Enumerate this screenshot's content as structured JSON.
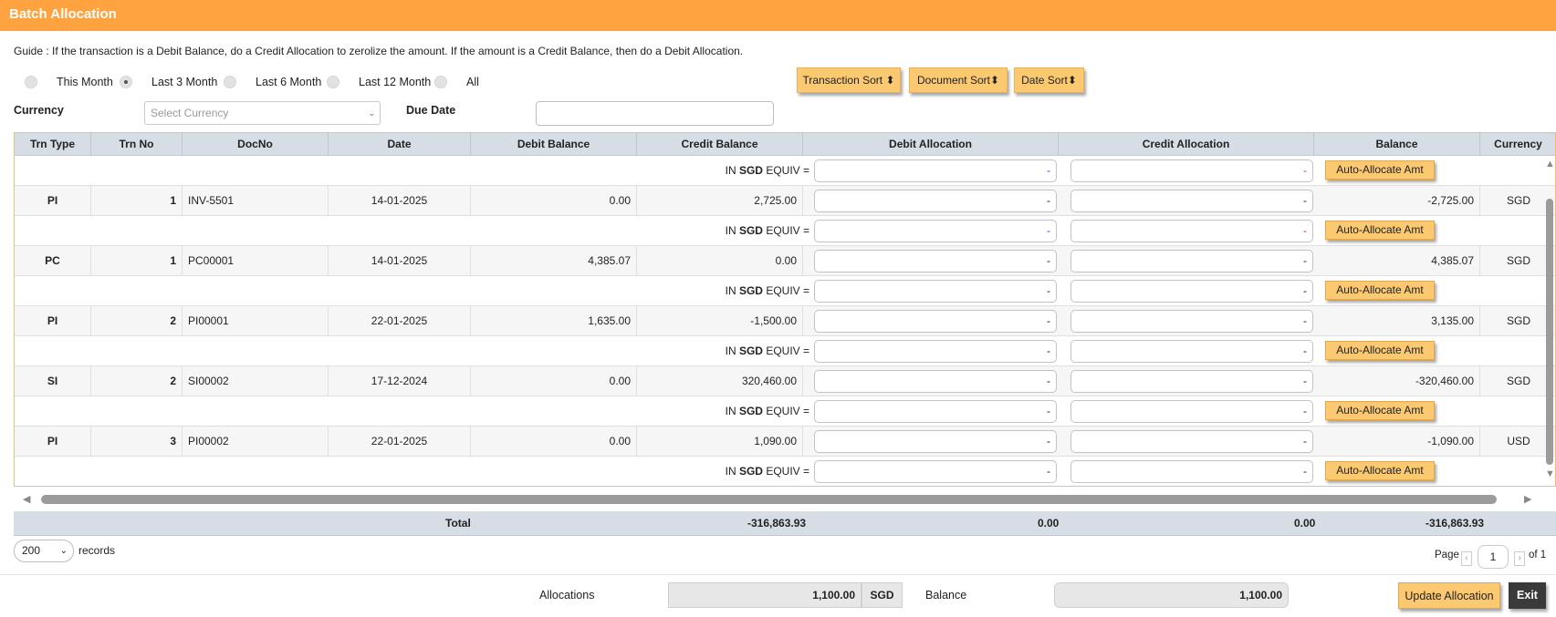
{
  "window": {
    "title": "Batch Allocation"
  },
  "guide": "Guide : If the transaction is a Debit Balance, do a Credit Allocation to zerolize the amount. If the amount is a Credit Balance, then do a Debit Allocation.",
  "period": {
    "selected": "Last 3 Month",
    "options": [
      "This Month",
      "Last 3 Month",
      "Last 6 Month",
      "Last 12 Month",
      "All"
    ]
  },
  "sort_buttons": [
    "Transaction Sort",
    "Document Sort",
    "Date Sort"
  ],
  "filters": {
    "currency_label": "Currency",
    "currency_placeholder": "Select Currency",
    "due_date_label": "Due Date",
    "due_date_value": ""
  },
  "table": {
    "columns": [
      "Trn Type",
      "Trn No",
      "DocNo",
      "Date",
      "Debit Balance",
      "Credit Balance",
      "Debit Allocation",
      "Credit Allocation",
      "Balance",
      "Currency"
    ],
    "equiv_text": {
      "prefix": "IN",
      "currency": "SGD",
      "suffix": "EQUIV ="
    },
    "alloc_placeholder": "-",
    "auto_button": "Auto-Allocate Amt",
    "rows": [
      {
        "trn_type": "PI",
        "trn_no": "1",
        "doc_no": "INV-5501",
        "date": "14-01-2025",
        "debit_balance": "0.00",
        "credit_balance": "2,725.00",
        "balance": "-2,725.00",
        "currency": "SGD"
      },
      {
        "trn_type": "PC",
        "trn_no": "1",
        "doc_no": "PC00001",
        "date": "14-01-2025",
        "debit_balance": "4,385.07",
        "credit_balance": "0.00",
        "balance": "4,385.07",
        "currency": "SGD"
      },
      {
        "trn_type": "PI",
        "trn_no": "2",
        "doc_no": "PI00001",
        "date": "22-01-2025",
        "debit_balance": "1,635.00",
        "credit_balance": "-1,500.00",
        "balance": "3,135.00",
        "currency": "SGD"
      },
      {
        "trn_type": "SI",
        "trn_no": "2",
        "doc_no": "SI00002",
        "date": "17-12-2024",
        "debit_balance": "0.00",
        "credit_balance": "320,460.00",
        "balance": "-320,460.00",
        "currency": "SGD"
      },
      {
        "trn_type": "PI",
        "trn_no": "3",
        "doc_no": "PI00002",
        "date": "22-01-2025",
        "debit_balance": "0.00",
        "credit_balance": "1,090.00",
        "balance": "-1,090.00",
        "currency": "USD"
      }
    ]
  },
  "totals": {
    "label": "Total",
    "credit_balance": "-316,863.93",
    "debit_allocation": "0.00",
    "credit_allocation": "0.00",
    "balance": "-316,863.93"
  },
  "paging": {
    "page_size": "200",
    "records_label": "records",
    "page_label": "Page",
    "page_value": "1",
    "of_label": "of 1"
  },
  "footer": {
    "allocations_label": "Allocations",
    "allocations_value": "1,100.00",
    "currency": "SGD",
    "balance_label": "Balance",
    "balance_value": "1,100.00",
    "update_button": "Update Allocation",
    "exit_button": "Exit"
  },
  "colors": {
    "title_bar": "#ffa340",
    "button": "#fcc973",
    "header": "#d6dde4",
    "exit": "#3a3a3a"
  }
}
